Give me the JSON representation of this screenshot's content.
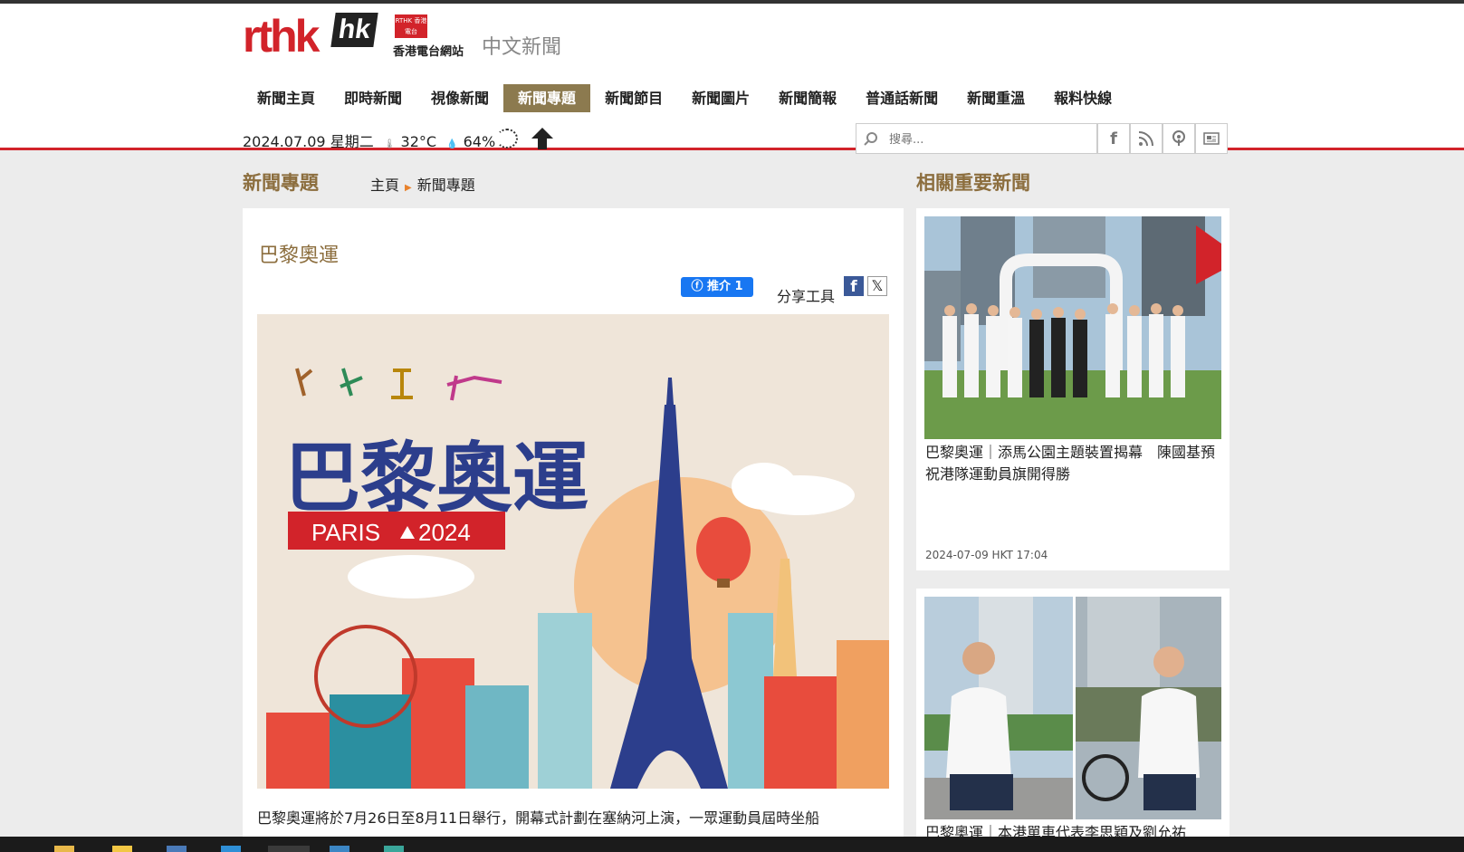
{
  "site": {
    "logo_text": "rthk",
    "logo_hk": "hk",
    "logo_badge": "RTHK 香港電台",
    "logo_sub": "香港電台網站",
    "section": "中文新聞"
  },
  "nav": {
    "items": [
      {
        "label": "新聞主頁"
      },
      {
        "label": "即時新聞"
      },
      {
        "label": "視像新聞"
      },
      {
        "label": "新聞專題",
        "active": true
      },
      {
        "label": "新聞節目"
      },
      {
        "label": "新聞圖片"
      },
      {
        "label": "新聞簡報"
      },
      {
        "label": "普通話新聞"
      },
      {
        "label": "新聞重溫"
      },
      {
        "label": "報料快線"
      }
    ]
  },
  "info": {
    "date": "2024.07.09",
    "weekday": "星期二",
    "temperature": "32°C",
    "humidity": "64%"
  },
  "search": {
    "placeholder": "搜尋..."
  },
  "social_icons": [
    "facebook-icon",
    "rss-icon",
    "podcast-icon",
    "newspaper-icon"
  ],
  "page": {
    "section_title": "新聞專題",
    "breadcrumb": [
      "主頁",
      "新聞專題"
    ],
    "right_title": "相關重要新聞"
  },
  "article": {
    "title": "巴黎奧運",
    "like_label": "推介 1",
    "share_label": "分享工具",
    "banner": {
      "title": "巴黎奧運",
      "subtitle": "PARIS",
      "year": "2024"
    },
    "body": "巴黎奧運將於7月26日至8月11日舉行，開幕式計劃在塞納河上演，一眾運動員屆時坐船"
  },
  "related": [
    {
      "title": "巴黎奧運｜添馬公園主題裝置揭幕　陳國基預祝港隊運動員旗開得勝",
      "time": "2024-07-09 HKT 17:04"
    },
    {
      "title": "巴黎奧運｜本港單車代表李思穎及劉允祐",
      "time": ""
    }
  ],
  "colors": {
    "brand_red": "#d2232a",
    "accent_gold": "#8c7a4f",
    "heading_brown": "#8c6e3e",
    "facebook_blue": "#1877f2"
  }
}
